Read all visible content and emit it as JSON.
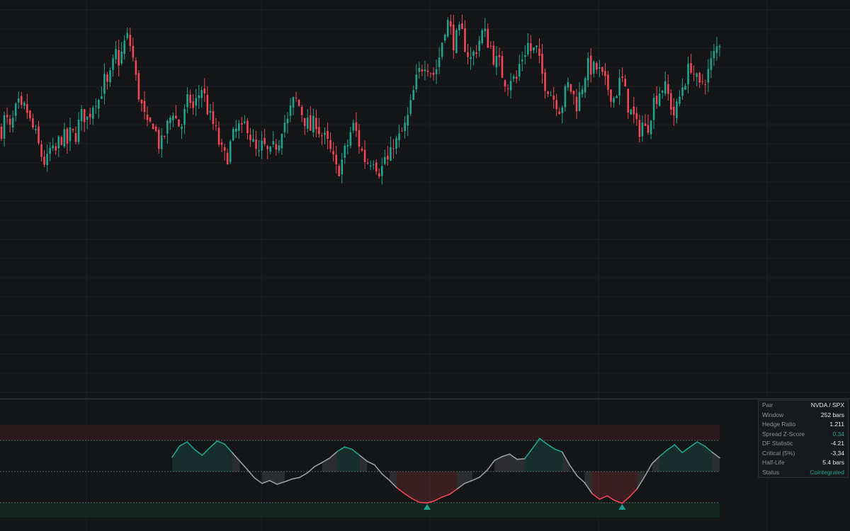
{
  "colors": {
    "background": "#141517",
    "grid": "#1e1f23",
    "up": "#1fa38f",
    "down": "#ef4757",
    "neutral": "#9a9ca1",
    "upper_band_fill": "#2a1a1d",
    "lower_band_fill": "#13251f",
    "dotted_line": "#5c5e63"
  },
  "info_panel": {
    "rows": [
      {
        "label": "Pair",
        "value": "NVDA / SPX"
      },
      {
        "label": "Window",
        "value": "252 bars"
      },
      {
        "label": "Hedge Ratio",
        "value": "1.211"
      },
      {
        "label": "Spread Z-Score",
        "value": "0.34"
      },
      {
        "label": "DF Statistic",
        "value": "-4.21"
      },
      {
        "label": "Critical (5%)",
        "value": "-3.34"
      },
      {
        "label": "Half-Life",
        "value": "5.4 bars"
      },
      {
        "label": "Status",
        "value": "Cointegrated"
      }
    ]
  },
  "chart_data": [
    {
      "type": "candlestick",
      "ylim": [
        88,
        152
      ],
      "grid": true,
      "price_path": [
        132.1,
        134.4,
        131.6,
        133.8,
        136.2,
        134.7,
        135.9,
        133.2,
        131.8,
        129.5,
        127.4,
        126.1,
        128.8,
        127.5,
        129.9,
        131.2,
        129.6,
        131.5,
        130.8,
        133.1,
        134.9,
        133.7,
        135.6,
        137.5,
        136.9,
        140.4,
        139.1,
        141.6,
        144.8,
        143.3,
        146.2,
        147.5,
        145.1,
        140.2,
        136.9,
        134.1,
        131.6,
        133.9,
        131.1,
        128.8,
        131.3,
        133.1,
        135.6,
        133.2,
        132.4,
        134.9,
        137.6,
        135.4,
        137.1,
        139.3,
        136.9,
        134.1,
        132.7,
        130.6,
        128.2,
        126.9,
        129.3,
        131.1,
        132.5,
        131.3,
        133.7,
        131.1,
        128.8,
        127.4,
        129.6,
        128.2,
        127.7,
        129.3,
        130.5,
        133.6,
        132.9,
        135.7,
        137.2,
        135.9,
        134.3,
        132.9,
        131.9,
        133.9,
        131.7,
        130.6,
        129.4,
        127.5,
        125.2,
        125.9,
        127.9,
        129.9,
        132.9,
        131.4,
        128.9,
        127.2,
        126.6,
        127.8,
        126.1,
        124.9,
        127.6,
        126.2,
        130.1,
        129.8,
        131.3,
        132.6,
        134.9,
        138.3,
        140.9,
        142.6,
        143.8,
        142.1,
        141.3,
        143.1,
        146.9,
        150.5,
        148.6,
        146.3,
        148.1,
        147.7,
        145.3,
        143.7,
        145.1,
        146.8,
        148.4,
        147.2,
        145.6,
        143.4,
        142.9,
        140.8,
        139.9,
        141.2,
        139.6,
        143.1,
        144.8,
        146.3,
        144.8,
        145.6,
        142.4,
        140.1,
        139.2,
        137.6,
        136.9,
        135.4,
        137.8,
        139.6,
        137.9,
        136.3,
        138.5,
        141.5,
        142.8,
        141.9,
        142.3,
        140.9,
        139.4,
        138.8,
        137.2,
        139.1,
        140.6,
        137.5,
        135.2,
        133.9,
        131.6,
        133.3,
        131.5,
        134.7,
        137.1,
        138.3,
        139.2,
        138.5,
        136.3,
        134.2,
        136.9,
        139.7,
        141.2,
        142.9,
        140.8,
        138.6,
        140.6,
        141.2,
        143.4,
        145.1,
        146.9
      ],
      "bars_drawn": 252
    },
    {
      "type": "line",
      "series": [
        {
          "values": [
            0.46,
            0.82,
            0.95,
            0.71,
            0.52,
            0.76,
            0.98,
            0.88,
            0.61,
            0.34,
            0.07,
            -0.21,
            -0.38,
            -0.29,
            -0.41,
            -0.33,
            -0.24,
            -0.19,
            -0.05,
            0.16,
            0.29,
            0.43,
            0.64,
            0.79,
            0.71,
            0.52,
            0.33,
            0.21,
            -0.08,
            -0.29,
            -0.53,
            -0.71,
            -0.87,
            -0.99,
            -1.01,
            -0.94,
            -0.82,
            -0.73,
            -0.56,
            -0.38,
            -0.29,
            -0.18,
            0.04,
            0.36,
            0.48,
            0.56,
            0.39,
            0.41,
            0.73,
            1.06,
            0.88,
            0.72,
            0.63,
            0.21,
            -0.14,
            -0.36,
            -0.71,
            -0.89,
            -0.78,
            -0.93,
            -1.02,
            -0.81,
            -0.55,
            -0.16,
            0.26,
            0.49,
            0.69,
            0.86,
            0.61,
            0.78,
            0.95,
            0.82,
            0.62,
            0.44
          ]
        }
      ],
      "thresholds": {
        "upper": 1.0,
        "mid": 0.0,
        "lower": -1.0
      },
      "signal_markers": 2
    }
  ]
}
